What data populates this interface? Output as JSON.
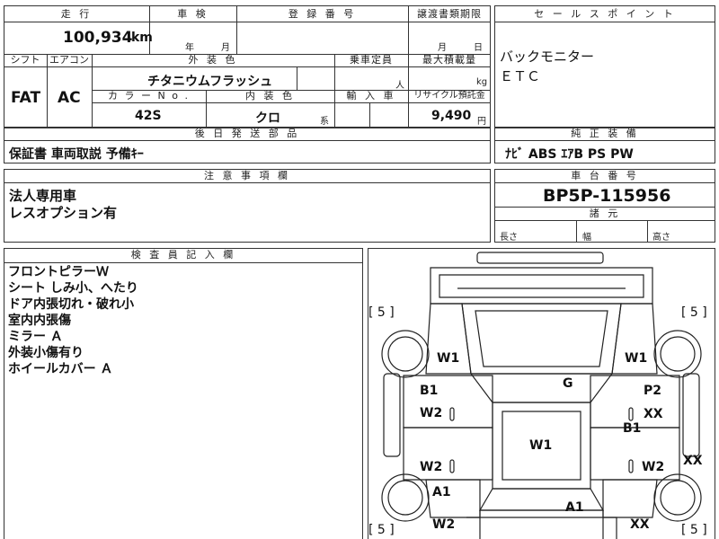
{
  "headers": {
    "mileage": "走 行",
    "inspection": "車 検",
    "registration_number": "登 録 番 号",
    "transfer_deadline": "譲渡書類期限",
    "sales_point": "セ ー ル ス ポ イ ン ト",
    "shift": "シフト",
    "aircon": "エアコン",
    "exterior_color": "外 装 色",
    "capacity": "乗車定員",
    "max_load": "最大積載量",
    "color_no": "カ ラ ー N o .",
    "interior_color": "内 装 色",
    "import": "輸 入 車",
    "recycle_fee": "リサイクル預託金",
    "later_parts": "後 日 発 送 部 品",
    "standard_equipment": "純 正 装 備",
    "notes": "注 意 事 項 欄",
    "chassis_number": "車 台 番 号",
    "specs": "諸 元",
    "inspector_notes": "検 査 員 記 入 欄"
  },
  "vehicle": {
    "mileage": "100,934",
    "mileage_unit": "km",
    "inspection_year_unit": "年",
    "inspection_month_unit": "月",
    "transfer_month_unit": "月",
    "transfer_day_unit": "日",
    "shift": "FAT",
    "aircon": "AC",
    "exterior_color": "チタニウムフラッシュ",
    "capacity_unit": "人",
    "max_load_unit": "kg",
    "color_no": "42S",
    "interior_color": "クロ",
    "interior_color_suffix": "系",
    "recycle_fee": "9,490",
    "recycle_fee_unit": "円",
    "later_parts": "保証書 車両取説 予備ｷｰ",
    "standard_equipment": "ﾅﾋﾞ ABS ｴｱB PS PW",
    "chassis_number": "BP5P-115956"
  },
  "sales_points": [
    "バックモニター",
    "ＥＴＣ"
  ],
  "notes": [
    "法人専用車",
    "レスオプション有"
  ],
  "specs": {
    "length_label": "長さ",
    "width_label": "幅",
    "height_label": "高さ"
  },
  "inspector_notes": [
    "フロントピラーＷ",
    "シート しみ小、へたり",
    "ドア内張切れ・破れ小",
    "室内内張傷",
    "ミラー Ａ",
    "外装小傷有り",
    "ホイールカバー Ａ"
  ],
  "diagram_marks": {
    "tire_front_left": "[ 5 ]",
    "tire_front_right": "[ 5 ]",
    "tire_rear_left": "[ 5 ]",
    "tire_rear_right": "[ 5 ]",
    "front_left_fender": "W1",
    "front_right_fender": "W1",
    "windshield": "G",
    "left_front_door_1": "B1",
    "left_front_door_2": "W2",
    "right_front_door_1": "P2",
    "right_front_door_2": "XX",
    "right_front_door_3": "B1",
    "roof": "W1",
    "left_rear_door": "W2",
    "right_rear_door": "W2",
    "right_side_panel": "XX",
    "left_rear_fender_1": "A1",
    "left_rear_fender_2": "W2",
    "rear_body": "A1",
    "right_rear_fender": "XX"
  }
}
